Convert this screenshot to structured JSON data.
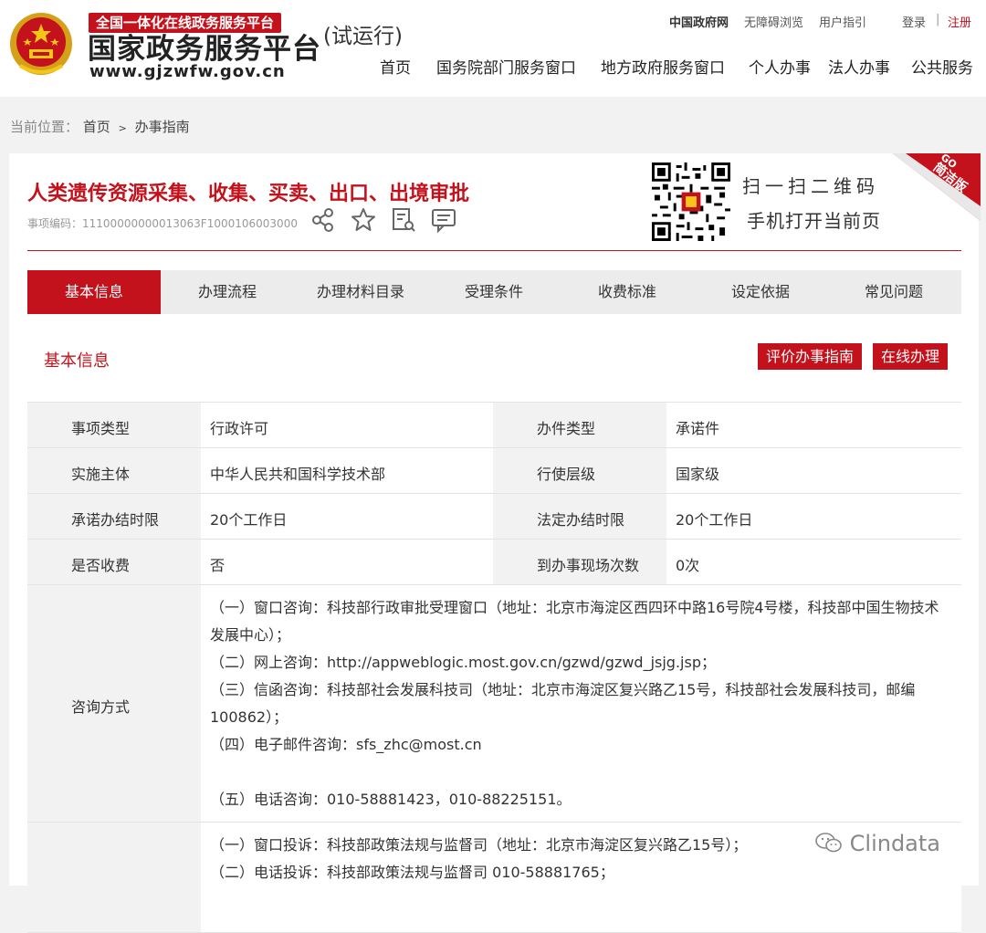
{
  "header": {
    "brand_top": "全国一体化在线政务服务平台",
    "brand_main": "国家政务服务平台",
    "brand_url": "www.gjzwfw.gov.cn",
    "brand_trial": "(试运行)",
    "top_links": {
      "gov": "中国政府网",
      "accessibility": "无障碍浏览",
      "guide": "用户指引",
      "login": "登录",
      "separator": "|",
      "register": "注册"
    },
    "nav": [
      "首页",
      "国务院部门服务窗口",
      "地方政府服务窗口",
      "个人办事",
      "法人办事",
      "公共服务"
    ]
  },
  "breadcrumb": {
    "prefix": "当前位置：",
    "home": "首页",
    "arrow": ">",
    "current": "办事指南"
  },
  "item": {
    "title": "人类遗传资源采集、收集、买卖、出口、出境审批",
    "code_label": "事项编码：",
    "code": "11100000000013063F1000106003000",
    "icons": [
      "share-icon",
      "star-icon",
      "document-search-icon",
      "comment-icon"
    ],
    "qr_line1": "扫一扫二维码",
    "qr_line2": "手机打开当前页",
    "corner_badge": "简洁版",
    "corner_go": "GO"
  },
  "tabs": [
    "基本信息",
    "办理流程",
    "办理材料目录",
    "受理条件",
    "收费标准",
    "设定依据",
    "常见问题"
  ],
  "section": {
    "title": "基本信息",
    "btn_evaluate": "评价办事指南",
    "btn_online": "在线办理"
  },
  "info_rows": [
    {
      "l1": "事项类型",
      "v1": "行政许可",
      "l2": "办件类型",
      "v2": "承诺件"
    },
    {
      "l1": "实施主体",
      "v1": "中华人民共和国科学技术部",
      "l2": "行使层级",
      "v2": "国家级"
    },
    {
      "l1": "承诺办结时限",
      "v1": "20个工作日",
      "l2": "法定办结时限",
      "v2": "20个工作日"
    },
    {
      "l1": "是否收费",
      "v1": "否",
      "l2": "到办事现场次数",
      "v2": "0次"
    }
  ],
  "consult": {
    "label": "咨询方式",
    "lines": [
      "（一）窗口咨询：科技部行政审批受理窗口（地址：北京市海淀区西四环中路16号院4号楼，科技部中国生物技术发展中心）；",
      "（二）网上咨询：http://appweblogic.most.gov.cn/gzwd/gzwd_jsjg.jsp；",
      "（三）信函咨询：科技部社会发展科技司（地址：北京市海淀区复兴路乙15号，科技部社会发展科技司，邮编100862）；",
      "（四）电子邮件咨询：sfs_zhc@most.cn",
      "",
      "（五）电话咨询：010-58881423，010-88225151。"
    ]
  },
  "complaint": {
    "lines": [
      "（一）窗口投诉：科技部政策法规与监督司（地址：北京市海淀区复兴路乙15号）；",
      "（二）电话投诉：科技部政策法规与监督司 010-58881765；"
    ]
  },
  "watermark": "Clindata",
  "colors": {
    "accent": "#c4121c",
    "label_bg": "#f2f2f2",
    "page_bg": "#f2f2f2"
  }
}
